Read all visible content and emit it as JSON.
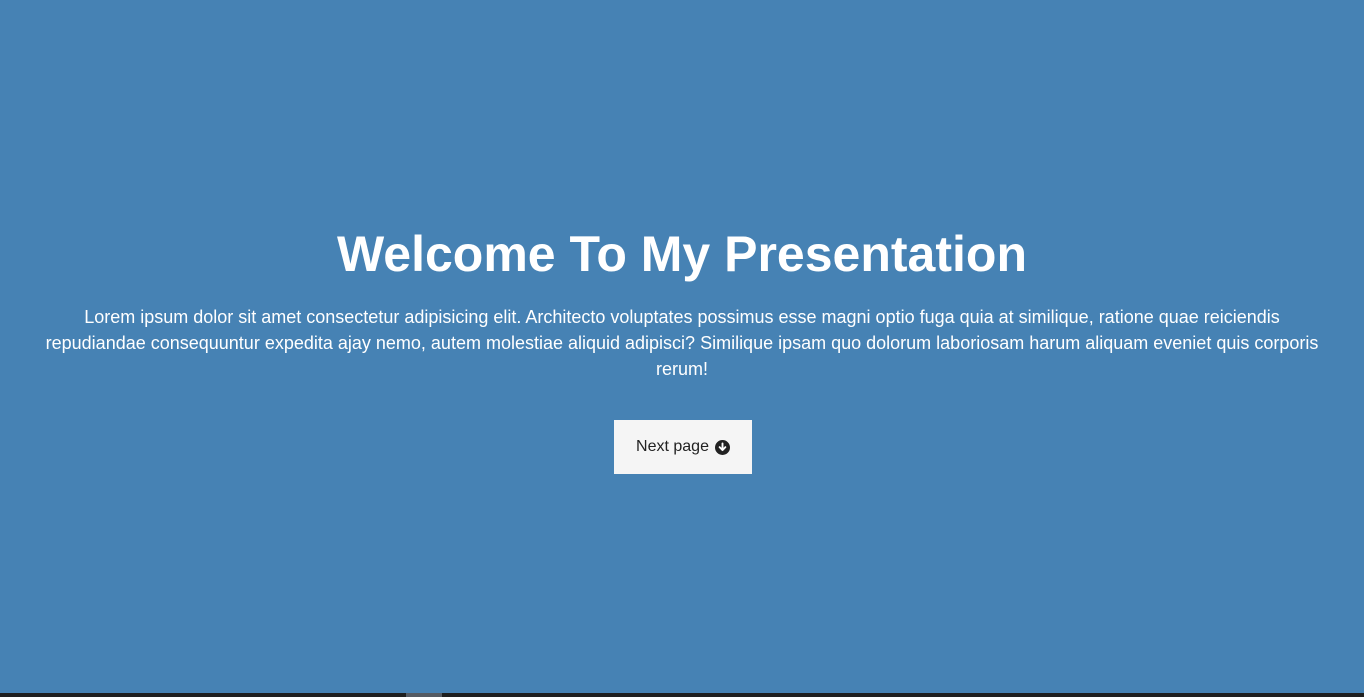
{
  "hero": {
    "title": "Welcome To My Presentation",
    "lead": "Lorem ipsum dolor sit amet consectetur adipisicing elit. Architecto voluptates possimus esse magni optio fuga quia at similique, ratione quae reiciendis repudiandae consequuntur expedita ajay nemo, autem molestiae aliquid adipisci? Similique ipsam quo dolorum laboriosam harum aliquam eveniet quis corporis rerum!",
    "button_label": "Next page",
    "button_icon": "arrow-circle-down-icon"
  },
  "colors": {
    "background": "#4682b4",
    "text": "#ffffff",
    "button_bg": "#f5f5f5",
    "button_text": "#222222"
  }
}
